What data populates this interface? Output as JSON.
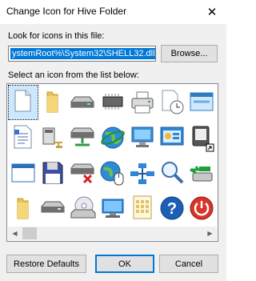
{
  "window": {
    "title": "Change Icon for Hive Folder",
    "close_glyph": "✕"
  },
  "look_for": {
    "label": "Look for icons in this file:",
    "value": "ystemRoot%\\System32\\SHELL32.dll",
    "browse_label": "Browse..."
  },
  "icon_list": {
    "label": "Select an icon from the list below:",
    "selected_index": 0,
    "icons": [
      {
        "name": "blank-document-icon"
      },
      {
        "name": "folder-icon"
      },
      {
        "name": "disk-drive-icon"
      },
      {
        "name": "memory-chip-icon"
      },
      {
        "name": "printer-icon"
      },
      {
        "name": "clock-document-icon"
      },
      {
        "name": "window-app-icon"
      },
      {
        "name": "text-document-icon"
      },
      {
        "name": "network-computer-icon"
      },
      {
        "name": "network-drive-icon"
      },
      {
        "name": "globe-icon"
      },
      {
        "name": "computer-monitor-icon"
      },
      {
        "name": "control-panel-icon"
      },
      {
        "name": "shortcut-app-icon"
      },
      {
        "name": "application-window-icon"
      },
      {
        "name": "floppy-drive-icon"
      },
      {
        "name": "disconnected-drive-icon"
      },
      {
        "name": "globe-mouse-icon"
      },
      {
        "name": "network-icon"
      },
      {
        "name": "search-icon"
      },
      {
        "name": "usb-drive-icon"
      },
      {
        "name": "yellow-folder-icon"
      },
      {
        "name": "hard-drive-icon"
      },
      {
        "name": "cd-drive-icon"
      },
      {
        "name": "desktop-monitor-icon"
      },
      {
        "name": "grid-document-icon"
      },
      {
        "name": "help-icon"
      },
      {
        "name": "power-icon"
      }
    ]
  },
  "buttons": {
    "restore_defaults": "Restore Defaults",
    "ok": "OK",
    "cancel": "Cancel"
  },
  "colors": {
    "accent": "#0078d7",
    "dialog_bg": "#f0f0f0",
    "selection_bg": "#cce8ff",
    "help_blue": "#1d5fb5",
    "power_red": "#d8352a"
  }
}
